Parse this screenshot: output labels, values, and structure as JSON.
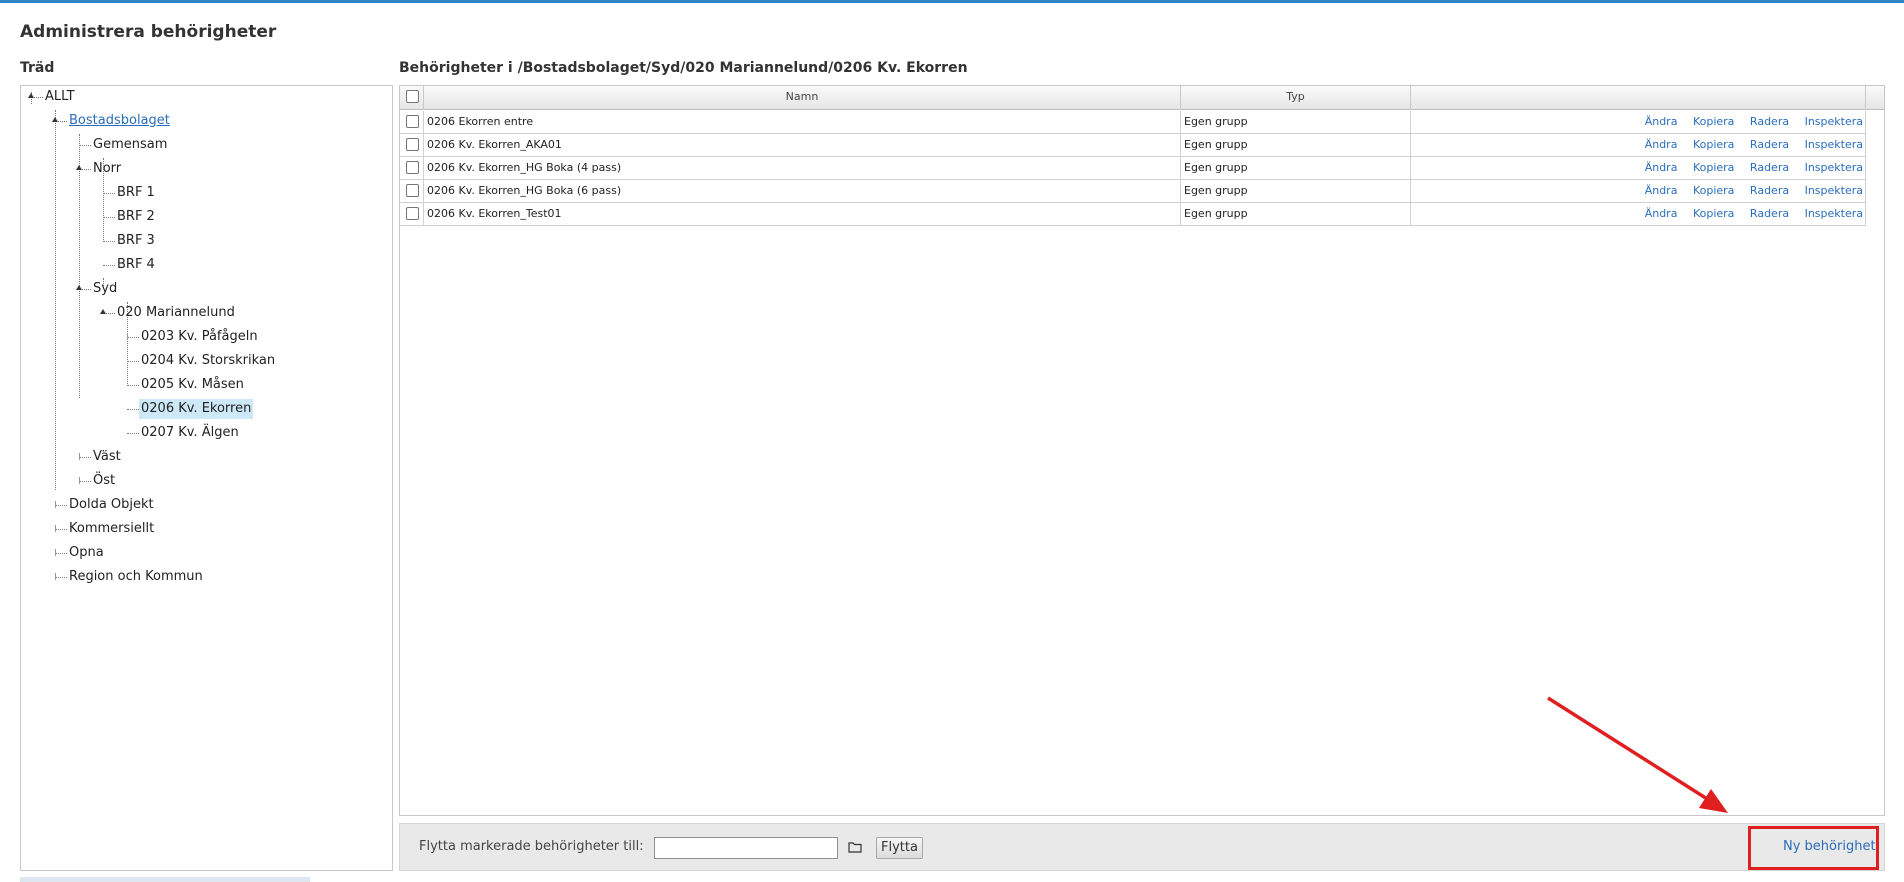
{
  "page_title": "Administrera behörigheter",
  "tree": {
    "heading": "Träd",
    "nodes": [
      {
        "label": "ALLT"
      },
      {
        "label": "Bostadsbolaget"
      },
      {
        "label": "Gemensam"
      },
      {
        "label": "Norr"
      },
      {
        "label": "BRF 1"
      },
      {
        "label": "BRF 2"
      },
      {
        "label": "BRF 3"
      },
      {
        "label": "BRF 4"
      },
      {
        "label": "Syd"
      },
      {
        "label": "020 Mariannelund"
      },
      {
        "label": "0203 Kv. Påfågeln"
      },
      {
        "label": "0204 Kv. Storskrikan"
      },
      {
        "label": "0205 Kv. Måsen"
      },
      {
        "label": "0206 Kv. Ekorren"
      },
      {
        "label": "0207 Kv. Älgen"
      },
      {
        "label": "Väst"
      },
      {
        "label": "Öst"
      },
      {
        "label": "Dolda Objekt"
      },
      {
        "label": "Kommersiellt"
      },
      {
        "label": "Opna"
      },
      {
        "label": "Region och Kommun"
      }
    ]
  },
  "permissions": {
    "heading": "Behörigheter i /Bostadsbolaget/Syd/020 Mariannelund/0206 Kv. Ekorren",
    "columns": {
      "name": "Namn",
      "type": "Typ"
    },
    "actions": {
      "edit": "Ändra",
      "copy": "Kopiera",
      "delete": "Radera",
      "inspect": "Inspektera"
    },
    "rows": [
      {
        "name": "0206 Ekorren entre",
        "type": "Egen grupp"
      },
      {
        "name": "0206 Kv. Ekorren_AKA01",
        "type": "Egen grupp"
      },
      {
        "name": "0206 Kv. Ekorren_HG Boka (4 pass)",
        "type": "Egen grupp"
      },
      {
        "name": "0206 Kv. Ekorren_HG Boka (6 pass)",
        "type": "Egen grupp"
      },
      {
        "name": "0206 Kv. Ekorren_Test01",
        "type": "Egen grupp"
      }
    ]
  },
  "bottom_bar": {
    "move_label": "Flytta markerade behörigheter till:",
    "move_input_value": "",
    "move_button": "Flytta",
    "new_permission_button": "Ny behörighet"
  },
  "icons": {
    "folder": "folder-icon"
  },
  "colors": {
    "accent": "#2f86c7",
    "link": "#2a6ebb",
    "selected": "#cde8f7",
    "annotation": "#e02020"
  }
}
